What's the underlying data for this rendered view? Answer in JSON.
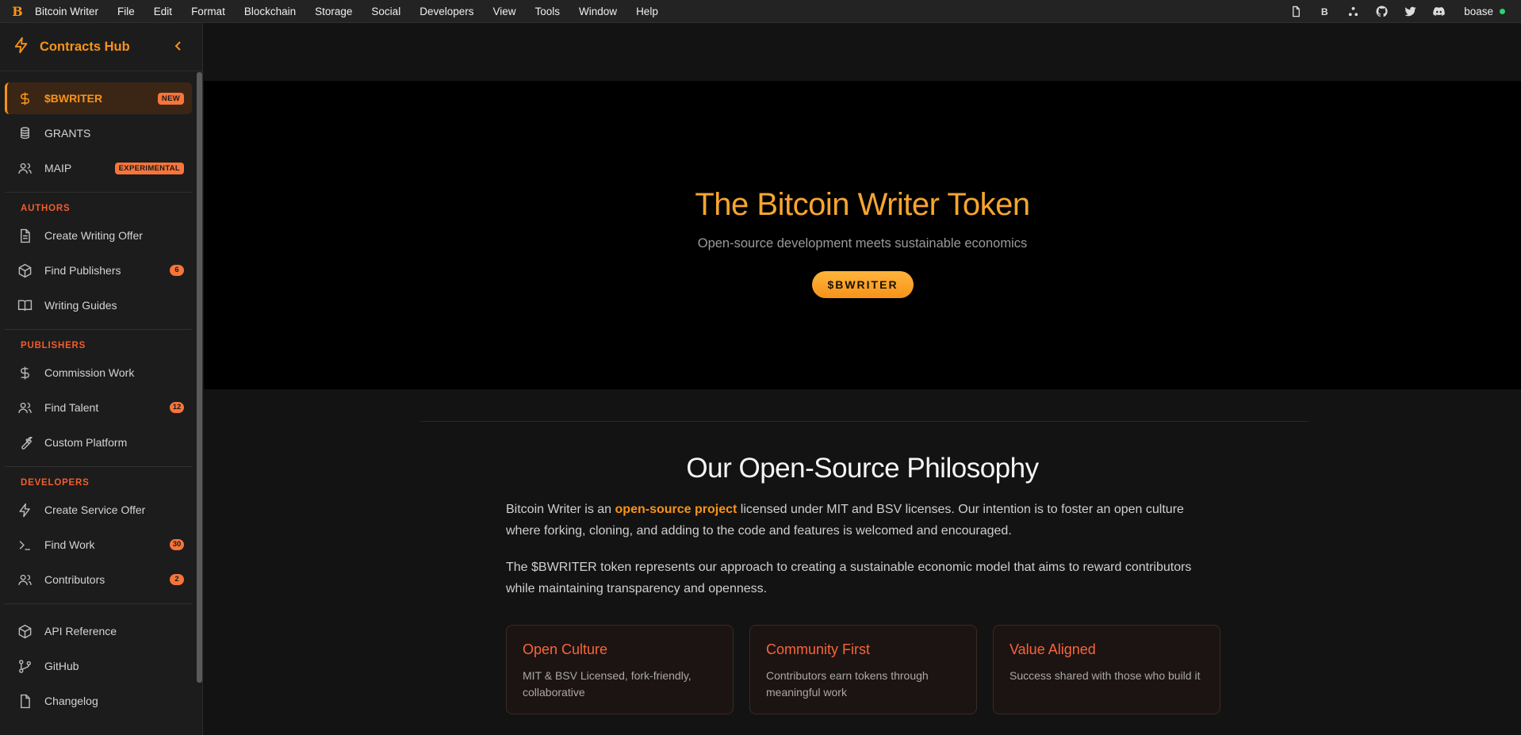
{
  "menubar": {
    "logo": "B",
    "items": [
      "Bitcoin Writer",
      "File",
      "Edit",
      "Format",
      "Blockchain",
      "Storage",
      "Social",
      "Developers",
      "View",
      "Tools",
      "Window",
      "Help"
    ],
    "right_icons": [
      "document-icon",
      "bitcoin-b-icon",
      "network-icon",
      "github-icon",
      "twitter-icon",
      "discord-icon"
    ],
    "user": "boase",
    "status_color": "#2bd46f"
  },
  "sidebar": {
    "title": "Contracts Hub",
    "top_items": [
      {
        "label": "$BWRITER",
        "icon": "dollar-icon",
        "badge": "NEW",
        "active": true
      },
      {
        "label": "GRANTS",
        "icon": "coins-icon"
      },
      {
        "label": "MAIP",
        "icon": "users-icon",
        "badge": "EXPERIMENTAL"
      }
    ],
    "sections": [
      {
        "title": "AUTHORS",
        "items": [
          {
            "label": "Create Writing Offer",
            "icon": "document-icon"
          },
          {
            "label": "Find Publishers",
            "icon": "package-icon",
            "count": "6"
          },
          {
            "label": "Writing Guides",
            "icon": "book-icon"
          }
        ]
      },
      {
        "title": "PUBLISHERS",
        "items": [
          {
            "label": "Commission Work",
            "icon": "dollar-icon"
          },
          {
            "label": "Find Talent",
            "icon": "users-icon",
            "count": "12"
          },
          {
            "label": "Custom Platform",
            "icon": "wrench-icon"
          }
        ]
      },
      {
        "title": "DEVELOPERS",
        "items": [
          {
            "label": "Create Service Offer",
            "icon": "bolt-icon"
          },
          {
            "label": "Find Work",
            "icon": "terminal-icon",
            "count": "30"
          },
          {
            "label": "Contributors",
            "icon": "users-icon",
            "count": "2"
          }
        ]
      }
    ],
    "footer_items": [
      {
        "label": "API Reference",
        "icon": "package-icon"
      },
      {
        "label": "GitHub",
        "icon": "git-branch-icon"
      },
      {
        "label": "Changelog",
        "icon": "document-icon"
      }
    ]
  },
  "hero": {
    "title": "The Bitcoin Writer Token",
    "subtitle": "Open-source development meets sustainable economics",
    "cta": "$BWRITER"
  },
  "philosophy": {
    "title": "Our Open-Source Philosophy",
    "p1_before": "Bitcoin Writer is an ",
    "p1_link": "open-source project",
    "p1_after": " licensed under MIT and BSV licenses. Our intention is to foster an open culture where forking, cloning, and adding to the code and features is welcomed and encouraged.",
    "p2": "The $BWRITER token represents our approach to creating a sustainable economic model that aims to reward contributors while maintaining transparency and openness.",
    "cards": [
      {
        "title": "Open Culture",
        "desc": "MIT & BSV Licensed, fork-friendly, collaborative"
      },
      {
        "title": "Community First",
        "desc": "Contributors earn tokens through meaningful work"
      },
      {
        "title": "Value Aligned",
        "desc": "Success shared with those who build it"
      }
    ]
  },
  "colors": {
    "accent": "#f7931a",
    "accent_red": "#f25d2c",
    "hero_gold": "#f7a530"
  }
}
